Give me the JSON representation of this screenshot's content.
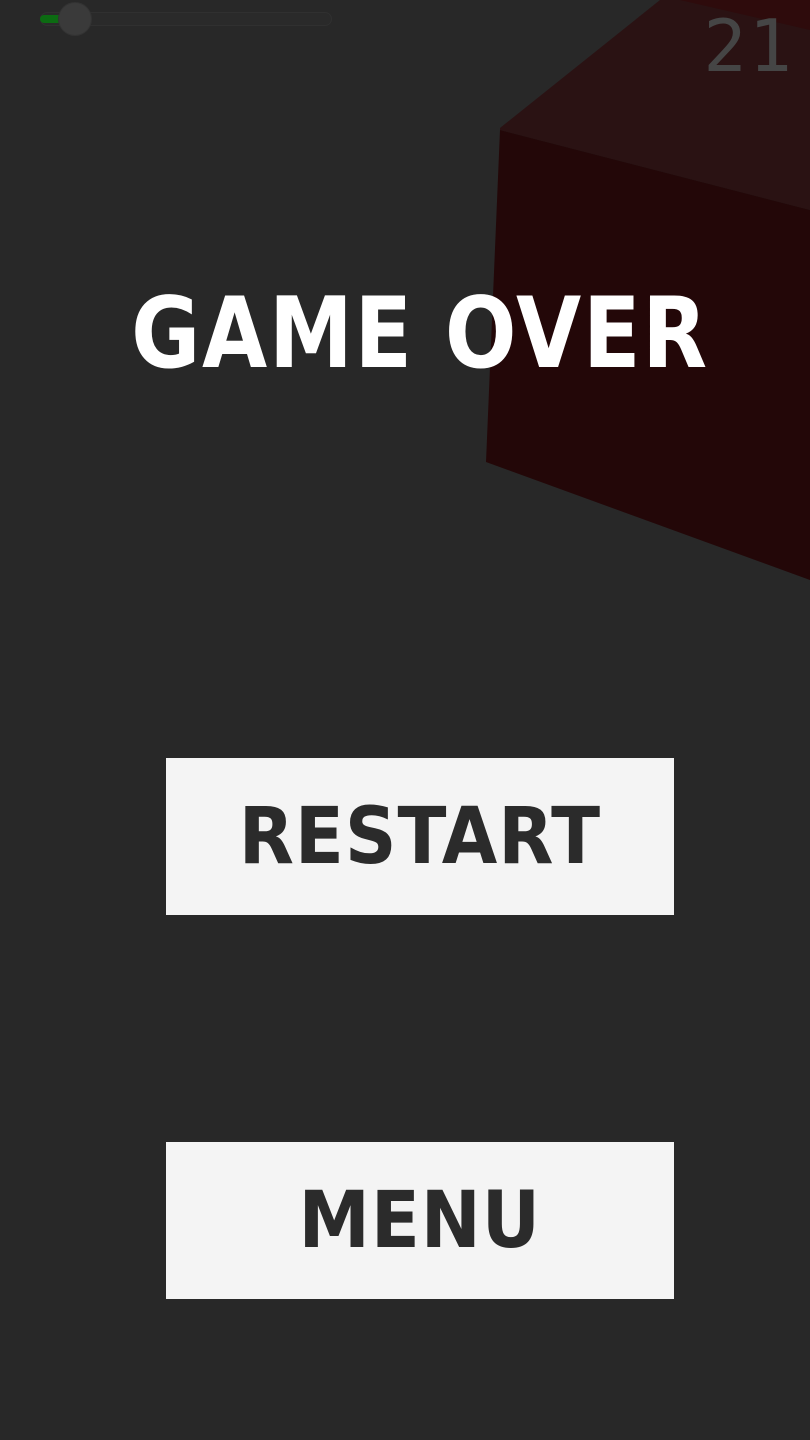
{
  "hud": {
    "score": "21",
    "progress": 0.12
  },
  "game_over": {
    "title": "GAME OVER"
  },
  "buttons": {
    "restart_label": "RESTART",
    "menu_label": "MENU"
  },
  "colors": {
    "background": "#282828",
    "cube_dark_red": "#230708",
    "cube_red": "#2e0b0c",
    "button_background": "#f4f4f4",
    "button_text": "#2b2b2b",
    "progress_green": "#0c6b12",
    "score_gray": "#454545"
  }
}
